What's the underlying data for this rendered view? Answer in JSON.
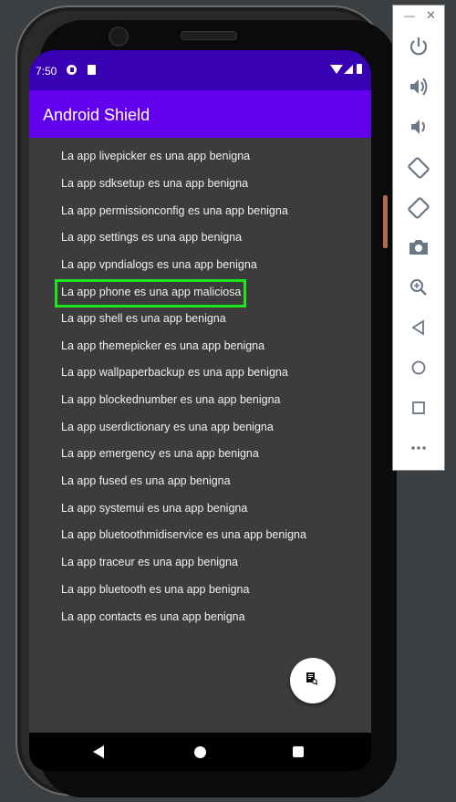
{
  "status_bar": {
    "time": "7:50"
  },
  "app_bar": {
    "title": "Android Shield"
  },
  "app_list": [
    "La app livepicker es una app benigna",
    "La app sdksetup es una app benigna",
    "La app permissionconfig es una app benigna",
    "La app settings es una app benigna",
    "La app vpndialogs es una app benigna",
    "La app phone es una app maliciosa",
    "La app shell es una app benigna",
    "La app themepicker es una app benigna",
    "La app wallpaperbackup es una app benigna",
    "La app blockednumber es una app benigna",
    "La app userdictionary es una app benigna",
    "La app emergency es una app benigna",
    "La app fused es una app benigna",
    "La app systemui es una app benigna",
    "La app bluetoothmidiservice es una app benigna",
    "La app traceur es una app benigna",
    "La app bluetooth es una app benigna",
    "La app contacts es una app benigna"
  ],
  "colors": {
    "status_bar": "#3700b3",
    "app_bar": "#6200ee",
    "screen_bg": "#3c3c3c",
    "highlight": "#1ee51e",
    "emulator_bg": "#3c3f41"
  },
  "icons": {
    "fab": "document-search-icon",
    "emulator_toolbar": [
      "power-icon",
      "volume-up-icon",
      "volume-down-icon",
      "rotate-left-icon",
      "rotate-right-icon",
      "camera-icon",
      "zoom-icon",
      "back-icon",
      "home-icon",
      "overview-icon",
      "more-icon"
    ]
  }
}
